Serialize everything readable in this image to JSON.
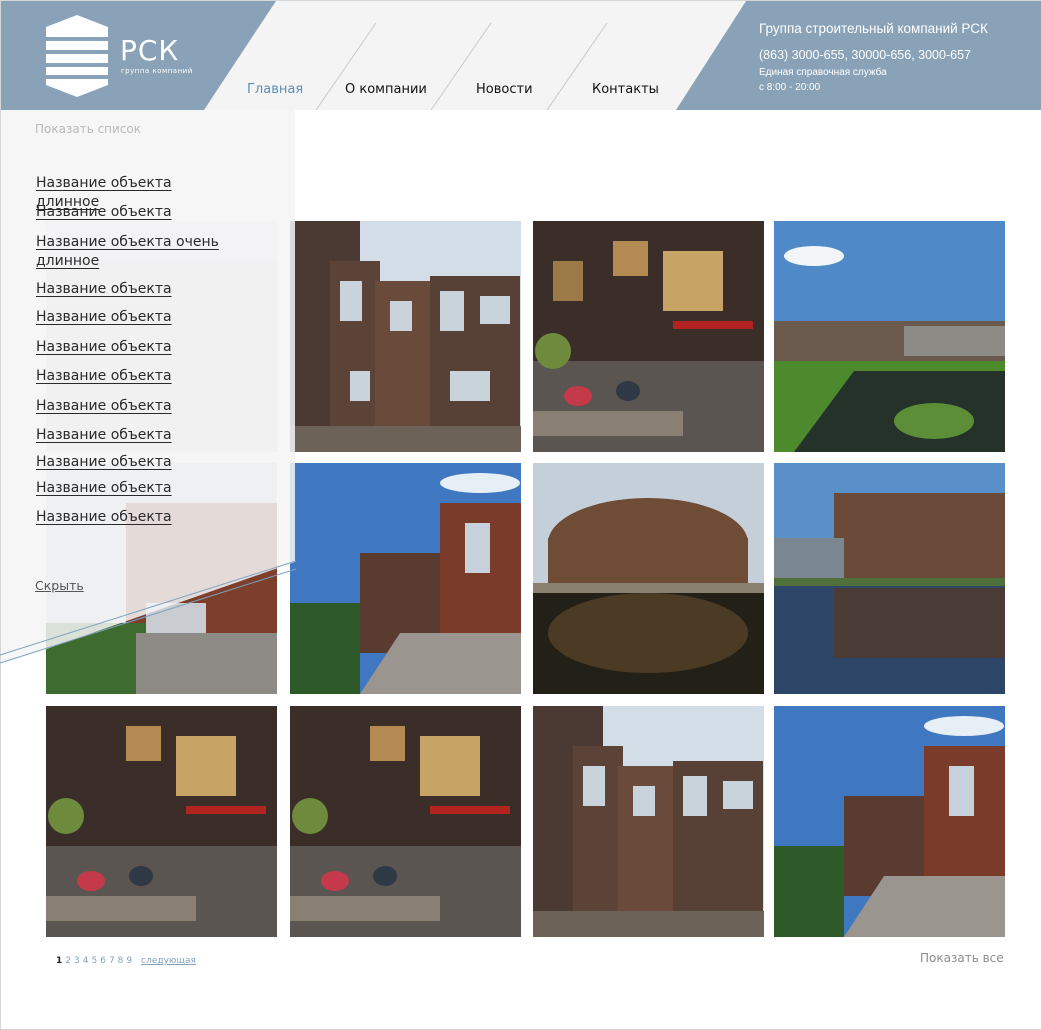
{
  "brand": {
    "name": "РСК",
    "subtitle": "группа компаний"
  },
  "nav": [
    "Главная",
    "О компании",
    "Новости",
    "Контакты"
  ],
  "contacts": {
    "title": "Группа строительный компаний РСК",
    "phones": "(863) 3000-655, 30000-656, 3000-657",
    "service": "Единая справочная служба",
    "hours": "с 8:00 - 20:00"
  },
  "panel": {
    "show_list": "Показать список",
    "hide": "Скрыть",
    "objects": [
      "Название объекта длинное",
      "Название объекта",
      "Название объекта очень длинное",
      "Название объекта",
      "Название объекта",
      "Название объекта",
      "Название объекта",
      "Название объекта",
      "Название объекта",
      "Название объекта",
      "Название объекта",
      "Название объекта"
    ]
  },
  "pagination": {
    "pages": [
      "1",
      "2",
      "3",
      "4",
      "5",
      "6",
      "7",
      "8",
      "9"
    ],
    "current": "1",
    "next": "следующая"
  },
  "show_all": "Показать все",
  "colors": {
    "header_blue": "#8aa2b7",
    "nav_active": "#5f8fb3",
    "link_blue": "#7fa3c0"
  }
}
